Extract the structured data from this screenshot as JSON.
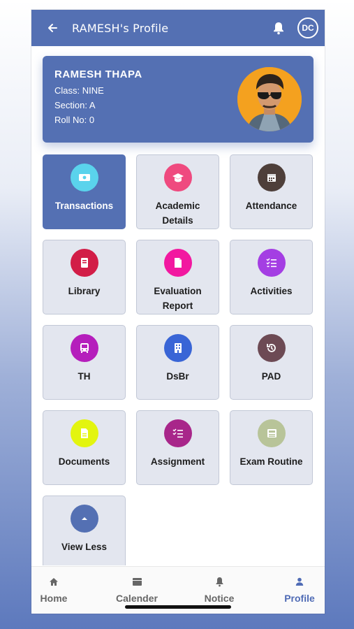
{
  "appbar": {
    "title": "RAMESH's Profile",
    "avatar_initials": "DC"
  },
  "profile": {
    "name": "RAMESH THAPA",
    "class_line": "Class: NINE",
    "section_line": "Section: A",
    "roll_line": "Roll No: 0"
  },
  "tiles": [
    {
      "label": "Transactions",
      "icon": "money-icon",
      "color": "#5ad3ec",
      "active": true
    },
    {
      "label": "Academic\nDetails",
      "icon": "graduation-cap-icon",
      "color": "#ef4a7f"
    },
    {
      "label": "Attendance",
      "icon": "calendar-icon",
      "color": "#4e3f3a"
    },
    {
      "label": "Library",
      "icon": "book-icon",
      "color": "#d21d47"
    },
    {
      "label": "Evaluation\nReport",
      "icon": "document-icon",
      "color": "#f218a0"
    },
    {
      "label": "Activities",
      "icon": "checklist-icon",
      "color": "#a43ee3"
    },
    {
      "label": "TH",
      "icon": "bus-icon",
      "color": "#b51ebc"
    },
    {
      "label": "DsBr",
      "icon": "building-icon",
      "color": "#3965d6"
    },
    {
      "label": "PAD",
      "icon": "history-icon",
      "color": "#6d4a54"
    },
    {
      "label": "Documents",
      "icon": "file-icon",
      "color": "#e3f50f"
    },
    {
      "label": "Assignment",
      "icon": "list-icon",
      "color": "#a8268a"
    },
    {
      "label": "Exam Routine",
      "icon": "newspaper-icon",
      "color": "#b8c499"
    },
    {
      "label": "View Less",
      "icon": "chevron-up-icon",
      "color": "#5470b3"
    }
  ],
  "nav": {
    "home": "Home",
    "calender": "Calender",
    "notice": "Notice",
    "profile": "Profile"
  }
}
